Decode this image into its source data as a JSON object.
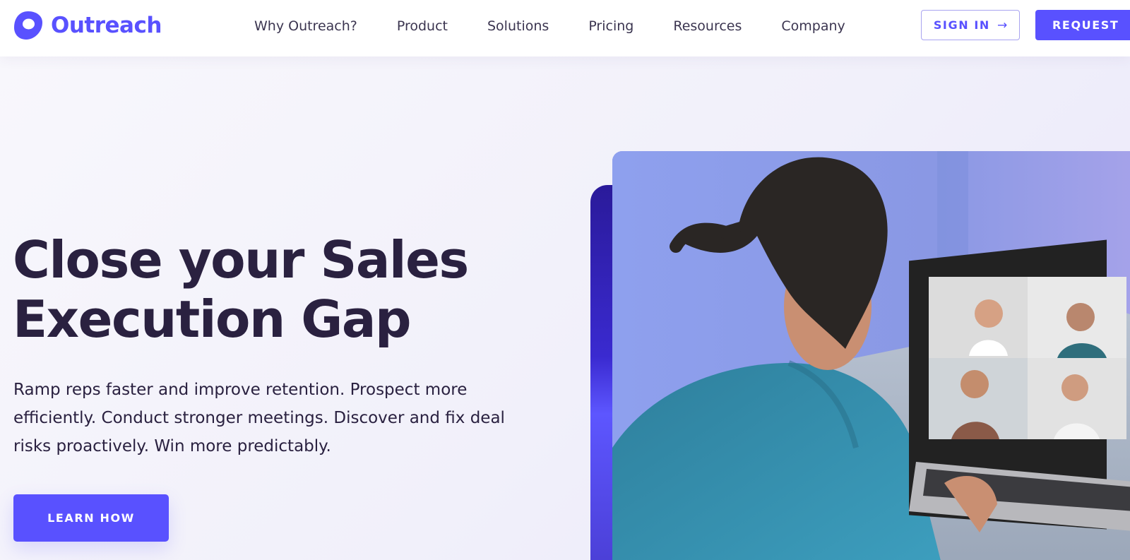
{
  "brand": {
    "name": "Outreach",
    "color": "#5951ff",
    "logo_icon": "outreach-shield-logo"
  },
  "nav": {
    "items": [
      "Why Outreach?",
      "Product",
      "Solutions",
      "Pricing",
      "Resources",
      "Company"
    ]
  },
  "header_actions": {
    "sign_in_label": "SIGN IN",
    "sign_in_icon": "arrow-right-icon",
    "request_label": "REQUEST"
  },
  "hero": {
    "headline": "Close your Sales Execution Gap",
    "subcopy": "Ramp reps faster and improve retention. Prospect more efficiently. Conduct stronger meetings. Discover and fix deal risks proactively. Win more predictably.",
    "cta_label": "LEARN HOW",
    "image": "woman-on-video-call-photo"
  },
  "colors": {
    "accent": "#5951ff",
    "headline": "#2a2140",
    "panel_dark": "#2a1a9a"
  }
}
